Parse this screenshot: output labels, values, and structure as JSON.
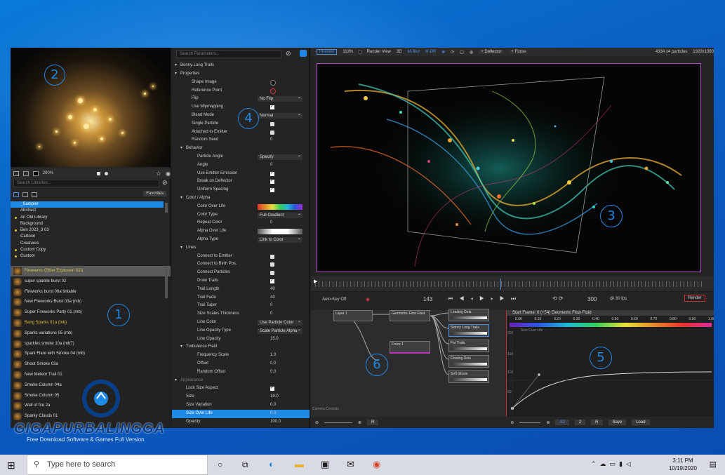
{
  "library": {
    "preview_zoom": "200%",
    "search_placeholder": "Search Libraries...",
    "favorites_label": "Favorites",
    "categories": [
      "_Sampler",
      "Abstract",
      "An Old Library",
      "Background",
      "Ben 2023_3 03",
      "Cartoon",
      "Creatures",
      "Custom Copy",
      "Custom"
    ],
    "presets": [
      "Fireworks Glitter Explosion 02a",
      "super sparkle burst 02",
      "Fireworks burst 06a tintable",
      "New Fireworks Burst 03a (mb)",
      "Super Fireworks Party 01 (mb)",
      "Bang Sparks 01a (mb)",
      "Sparks variations 05 (mb)",
      "sparkles smoke 10a (mb7)",
      "Spark Flare with Smoke 04 (mb)",
      "Shoot Smoke 03a",
      "New Meteor Trail 01",
      "Smoke Column 04a",
      "Smoke Column 05",
      "Wall of fire 2a",
      "Sparky Clouds 01"
    ]
  },
  "params": {
    "search_placeholder": "Search Parameters...",
    "emitter": "Skinny Long Trails",
    "rows": [
      {
        "t": "sec",
        "l": "Properties",
        "i": 1
      },
      {
        "t": "lbl",
        "l": "Shape Image",
        "i": 3
      },
      {
        "t": "lbl",
        "l": "Reference Point",
        "i": 3
      },
      {
        "t": "dd",
        "l": "Flip",
        "i": 3,
        "v": "No Flip"
      },
      {
        "t": "ccb",
        "l": "Use Mipmapping",
        "i": 3
      },
      {
        "t": "dd",
        "l": "Blend Mode",
        "i": 3,
        "v": "Normal"
      },
      {
        "t": "cb",
        "l": "Single Particle",
        "i": 3
      },
      {
        "t": "cb",
        "l": "Attached to Emitter",
        "i": 3
      },
      {
        "t": "val",
        "l": "Random Seed",
        "i": 3,
        "v": "0"
      },
      {
        "t": "sec",
        "l": "Behavior",
        "i": 2
      },
      {
        "t": "dd",
        "l": "Particle Angle",
        "i": 4,
        "v": "Specify"
      },
      {
        "t": "val",
        "l": "Angle",
        "i": 4,
        "v": "0"
      },
      {
        "t": "ccb",
        "l": "Use Emitter Emission",
        "i": 4
      },
      {
        "t": "ccb",
        "l": "Break on Deflector",
        "i": 4
      },
      {
        "t": "ccb",
        "l": "Uniform Spacing",
        "i": 4
      },
      {
        "t": "sec",
        "l": "Color / Alpha",
        "i": 2
      },
      {
        "t": "grad",
        "l": "Color Over Life",
        "i": 4
      },
      {
        "t": "dd",
        "l": "Color Type",
        "i": 4,
        "v": "Full Gradient"
      },
      {
        "t": "val",
        "l": "Repeat Color",
        "i": 4,
        "v": "0"
      },
      {
        "t": "agrad",
        "l": "Alpha Over Life",
        "i": 4
      },
      {
        "t": "dd",
        "l": "Alpha Type",
        "i": 4,
        "v": "Link to Color"
      },
      {
        "t": "sec",
        "l": "Lines",
        "i": 2
      },
      {
        "t": "cb",
        "l": "Connect to Emitter",
        "i": 4
      },
      {
        "t": "cb",
        "l": "Connect to Birth Pos.",
        "i": 4
      },
      {
        "t": "cb",
        "l": "Connect Particles",
        "i": 4
      },
      {
        "t": "ccb",
        "l": "Draw Trails",
        "i": 4
      },
      {
        "t": "val",
        "l": "Trail Length",
        "i": 4,
        "v": "40"
      },
      {
        "t": "val",
        "l": "Trail Fade",
        "i": 4,
        "v": "40"
      },
      {
        "t": "val",
        "l": "Trail Taper",
        "i": 4,
        "v": "0"
      },
      {
        "t": "val",
        "l": "Size Scales Thickness",
        "i": 4,
        "v": "0"
      },
      {
        "t": "dd",
        "l": "Line Color",
        "i": 4,
        "v": "Use Particle Color"
      },
      {
        "t": "dd",
        "l": "Line Opacity Type",
        "i": 4,
        "v": "Scale Particle Alpha"
      },
      {
        "t": "val",
        "l": "Line Opacity",
        "i": 4,
        "v": "15.0"
      },
      {
        "t": "sec",
        "l": "Turbulence Field",
        "i": 2
      },
      {
        "t": "val",
        "l": "Frequency Scale",
        "i": 4,
        "v": "1.0"
      },
      {
        "t": "val",
        "l": "Offset",
        "i": 4,
        "v": "0.0"
      },
      {
        "t": "val",
        "l": "Random Offset",
        "i": 4,
        "v": "0.0"
      },
      {
        "t": "sec2",
        "l": "Appearance",
        "i": 1
      },
      {
        "t": "ccb",
        "l": "Lock Size Aspect",
        "i": 2
      },
      {
        "t": "val",
        "l": "Size",
        "i": 2,
        "v": "19.0"
      },
      {
        "t": "val",
        "l": "Size Variation",
        "i": 2,
        "v": "0.0"
      },
      {
        "t": "sel",
        "l": "Size Over Life",
        "i": 2,
        "v": "0.0"
      },
      {
        "t": "val",
        "l": "Opacity",
        "i": 2,
        "v": "100.0"
      }
    ]
  },
  "viewer": {
    "tabs": [
      "Preview",
      "113%",
      "Render View",
      "3D",
      "M-Blur",
      "H-DR"
    ],
    "deflector_label": "+ Deflector",
    "force_label": "+ Force",
    "particles": "4334 x4 particles",
    "resolution": "1920x1080"
  },
  "transport": {
    "autokey": "Auto-Key Off",
    "frame": "143",
    "end": "300",
    "fps": "@ 30 fps",
    "render": "Render"
  },
  "graph": {
    "nodes": [
      "Layer 1",
      "Geometric Flow Fluid",
      "Force 1",
      "Leading Dots",
      "Skinny Long Trails",
      "Fat Trails",
      "Flowing Dots",
      "Soft Glows"
    ],
    "camera": "Camera Controls"
  },
  "curve": {
    "header": "Start Frame: 0  (+54)  Geometric Flow Fluid",
    "ticks": [
      "0.00",
      "0.10",
      "0.20",
      "0.30",
      "0.40",
      "0.50",
      "0.60",
      "0.70",
      "0.80",
      "0.90",
      "1.00"
    ],
    "label": "Size Over Life",
    "y": [
      "200",
      "150",
      "100",
      "50"
    ]
  },
  "status": {
    "a2": "A2",
    "two": "2",
    "r": "R",
    "save": "Save",
    "load": "Load"
  },
  "callouts": [
    "1",
    "2",
    "3",
    "4",
    "5",
    "6"
  ],
  "taskbar": {
    "search": "Type here to search",
    "time": "3:11 PM",
    "date": "10/19/2020"
  },
  "watermark": {
    "name": "GIGAPURBALINGGA",
    "tag": "Free Download Software & Games Full Version"
  }
}
